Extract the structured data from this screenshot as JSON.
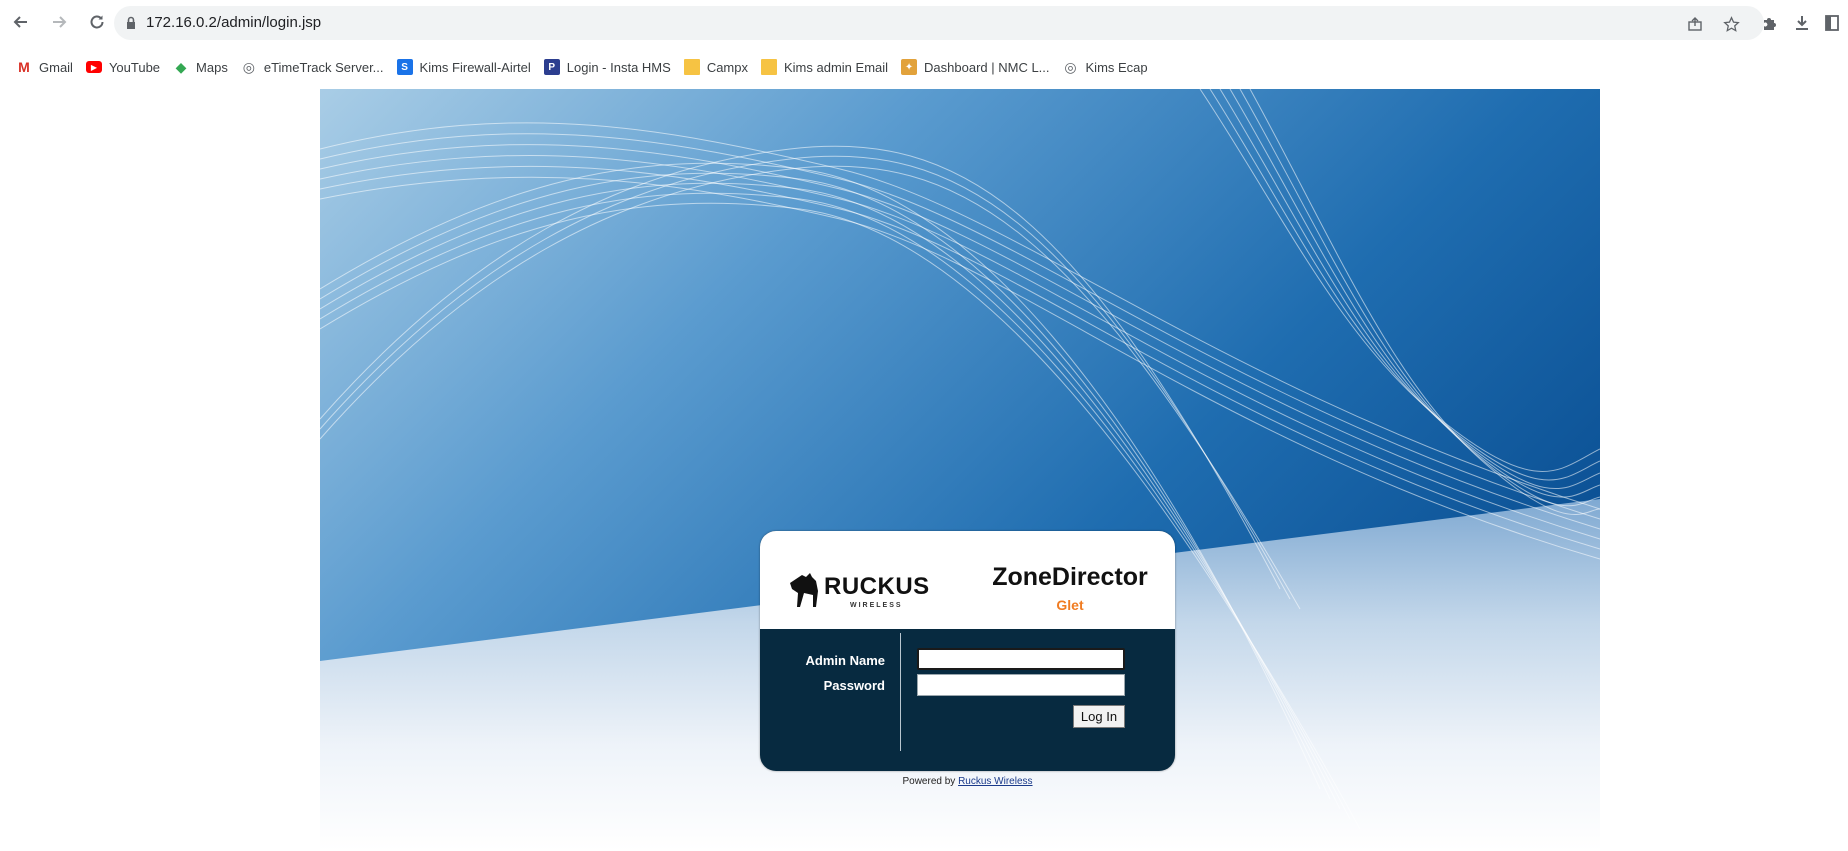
{
  "browser": {
    "url": "172.16.0.2/admin/login.jsp",
    "icons": {
      "back": "arrow-left",
      "forward": "arrow-right",
      "reload": "reload",
      "lock": "lock",
      "share": "share",
      "bookmark": "star",
      "extensions": "puzzle",
      "download": "download",
      "side_panel": "side-panel"
    }
  },
  "bookmarks": [
    {
      "label": "Gmail",
      "icon": "gmail-icon",
      "color": "#d93025",
      "glyph": "M"
    },
    {
      "label": "YouTube",
      "icon": "youtube-icon",
      "color": "#ff0000",
      "glyph": "▶"
    },
    {
      "label": "Maps",
      "icon": "maps-icon",
      "color": "#34a853",
      "glyph": "◆"
    },
    {
      "label": "eTimeTrack Server...",
      "icon": "globe-icon",
      "color": "#5f6368",
      "glyph": "◎"
    },
    {
      "label": "Kims Firewall-Airtel",
      "icon": "site-icon",
      "color": "#1a73e8",
      "glyph": "S"
    },
    {
      "label": "Login - Insta HMS",
      "icon": "site-icon",
      "color": "#2c3e8f",
      "glyph": "P"
    },
    {
      "label": "Campx",
      "icon": "folder-icon",
      "color": "#f6c343",
      "glyph": ""
    },
    {
      "label": "Kims admin Email",
      "icon": "folder-icon",
      "color": "#f6c343",
      "glyph": ""
    },
    {
      "label": "Dashboard | NMC L...",
      "icon": "site-icon",
      "color": "#e2a23b",
      "glyph": "✦"
    },
    {
      "label": "Kims Ecap",
      "icon": "globe-icon",
      "color": "#5f6368",
      "glyph": "◎"
    }
  ],
  "login": {
    "brand": "RUCKUS",
    "brand_sub": "WIRELESS",
    "product": "ZoneDirector",
    "product_sub": "Glet",
    "admin_label": "Admin Name",
    "password_label": "Password",
    "admin_value": "",
    "password_value": "",
    "button_label": "Log In",
    "accent_color": "#f07c22",
    "panel_color": "#072a40"
  },
  "footer": {
    "powered_prefix": "Powered by ",
    "powered_link": "Ruckus Wireless"
  }
}
